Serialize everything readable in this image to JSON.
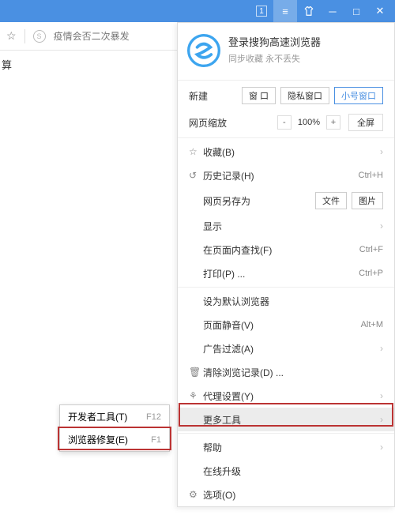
{
  "titlebar": {
    "tabcount": "1"
  },
  "addrbar": {
    "hint": "疫情会否二次暴发"
  },
  "leftlabel": "算",
  "account": {
    "title": "登录搜狗高速浏览器",
    "sub": "同步收藏 永不丢失"
  },
  "newrow": {
    "label": "新建",
    "b1": "窗 口",
    "b2": "隐私窗口",
    "b3": "小号窗口"
  },
  "zoom": {
    "label": "网页缩放",
    "val": "100%",
    "full": "全屏"
  },
  "items": {
    "fav": "收藏(B)",
    "history": "历史记录(H)",
    "history_sc": "Ctrl+H",
    "save": "网页另存为",
    "save_b1": "文件",
    "save_b2": "图片",
    "display": "显示",
    "find": "在页面内查找(F)",
    "find_sc": "Ctrl+F",
    "print": "打印(P) ...",
    "print_sc": "Ctrl+P",
    "default": "设为默认浏览器",
    "mute": "页面静音(V)",
    "mute_sc": "Alt+M",
    "adblock": "广告过滤(A)",
    "clear": "清除浏览记录(D) ...",
    "proxy": "代理设置(Y)",
    "more": "更多工具",
    "help": "帮助",
    "upgrade": "在线升级",
    "options": "选项(O)"
  },
  "submenu": {
    "dev": "开发者工具(T)",
    "dev_sc": "F12",
    "repair": "浏览器修复(E)",
    "repair_sc": "F1"
  }
}
